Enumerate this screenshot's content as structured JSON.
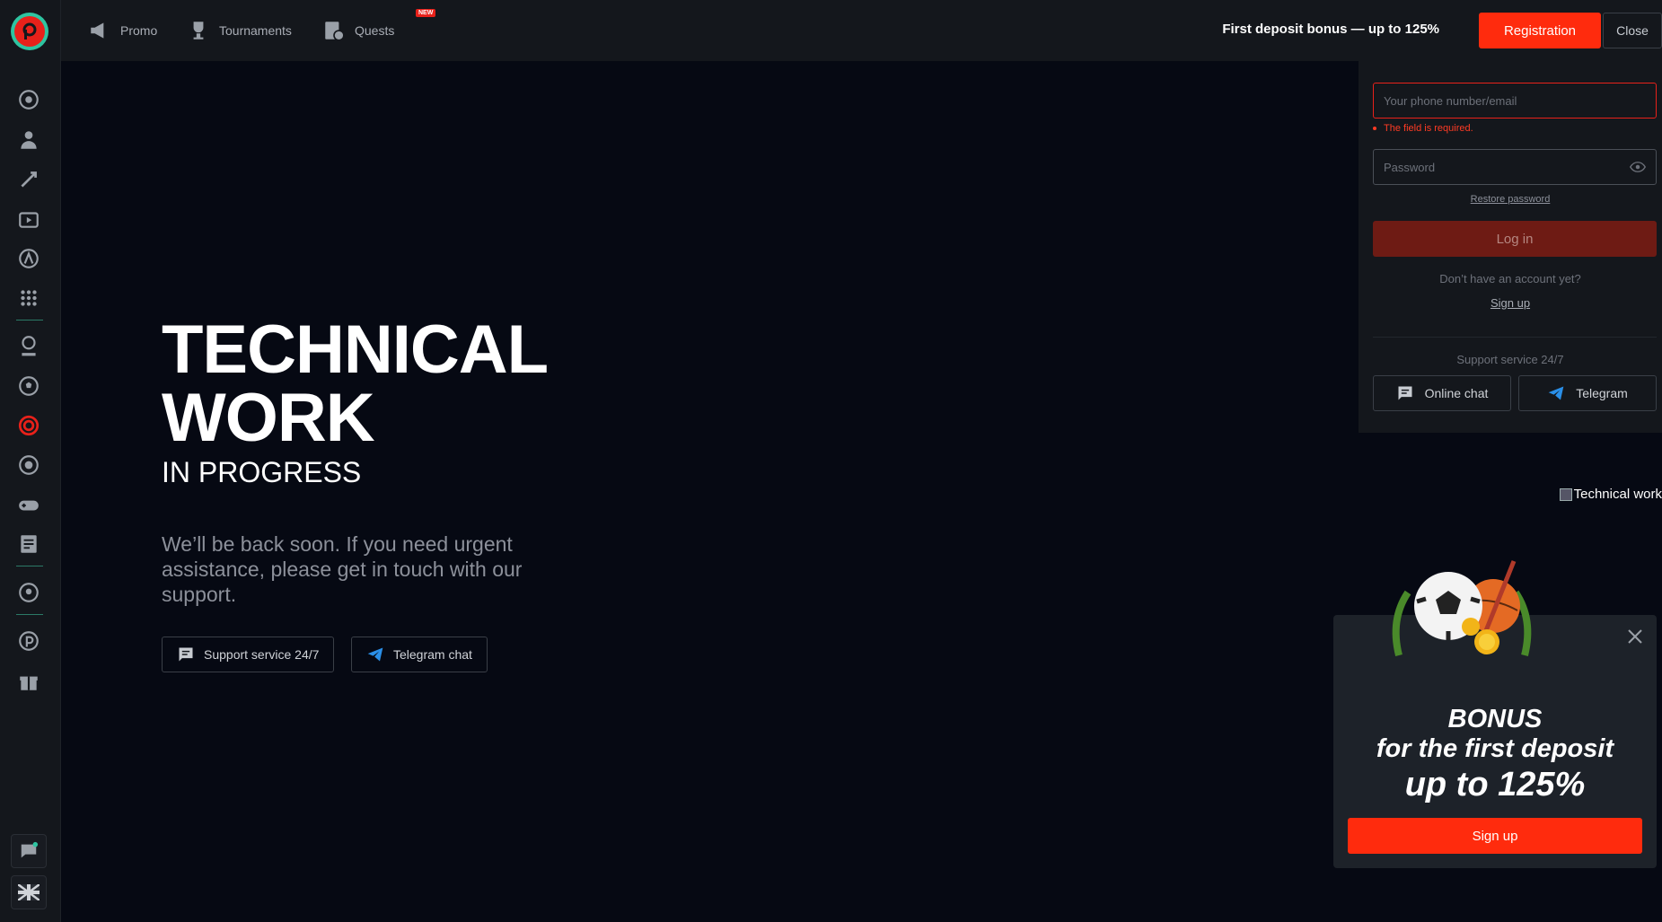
{
  "topbar": {
    "nav": [
      {
        "label": "Promo",
        "icon": "megaphone-icon"
      },
      {
        "label": "Tournaments",
        "icon": "trophy-icon"
      },
      {
        "label": "Quests",
        "icon": "quests-icon",
        "badge": "NEW"
      }
    ],
    "bonus_text": "First deposit bonus — up to 125%",
    "registration_label": "Registration",
    "close_label": "Close"
  },
  "sidebar": {
    "items": [
      {
        "icon": "sports-icon"
      },
      {
        "icon": "live-icon"
      },
      {
        "icon": "crash-games-icon"
      },
      {
        "icon": "tv-games-icon"
      },
      {
        "icon": "esports-icon"
      },
      {
        "icon": "bingo-icon"
      },
      {
        "icon": "football-player-icon"
      },
      {
        "icon": "football-icon"
      },
      {
        "icon": "target-icon"
      },
      {
        "icon": "virtual-sports-icon"
      },
      {
        "icon": "gamepad-icon"
      },
      {
        "icon": "results-icon"
      },
      {
        "icon": "support-icon"
      },
      {
        "icon": "brand-icon"
      },
      {
        "icon": "gift-icon"
      }
    ],
    "bottom": [
      {
        "icon": "chat-icon"
      },
      {
        "icon": "uk-flag-icon"
      }
    ]
  },
  "hero": {
    "title": "TECHNICAL WORK",
    "subtitle": "IN PROGRESS",
    "description": "We’ll be back soon. If you need urgent assistance, please get in touch with our support.",
    "support_button": "Support service 24/7",
    "telegram_button": "Telegram chat"
  },
  "login": {
    "phone_placeholder": "Your phone number/email",
    "error": "The field is required.",
    "password_placeholder": "Password",
    "restore": "Restore password",
    "login_button": "Log in",
    "no_account": "Don’t have an account yet?",
    "signup": "Sign up",
    "support_label": "Support service 24/7",
    "online_chat": "Online chat",
    "telegram": "Telegram"
  },
  "broken_image_alt": "Technical work",
  "bonus_popup": {
    "line1": "BONUS",
    "line2": "for the first deposit",
    "line3": "up to 125%",
    "signup": "Sign up"
  },
  "colors": {
    "accent_red": "#ff2b0d",
    "teal": "#2ec4a1",
    "telegram_blue": "#2a8fe8"
  }
}
